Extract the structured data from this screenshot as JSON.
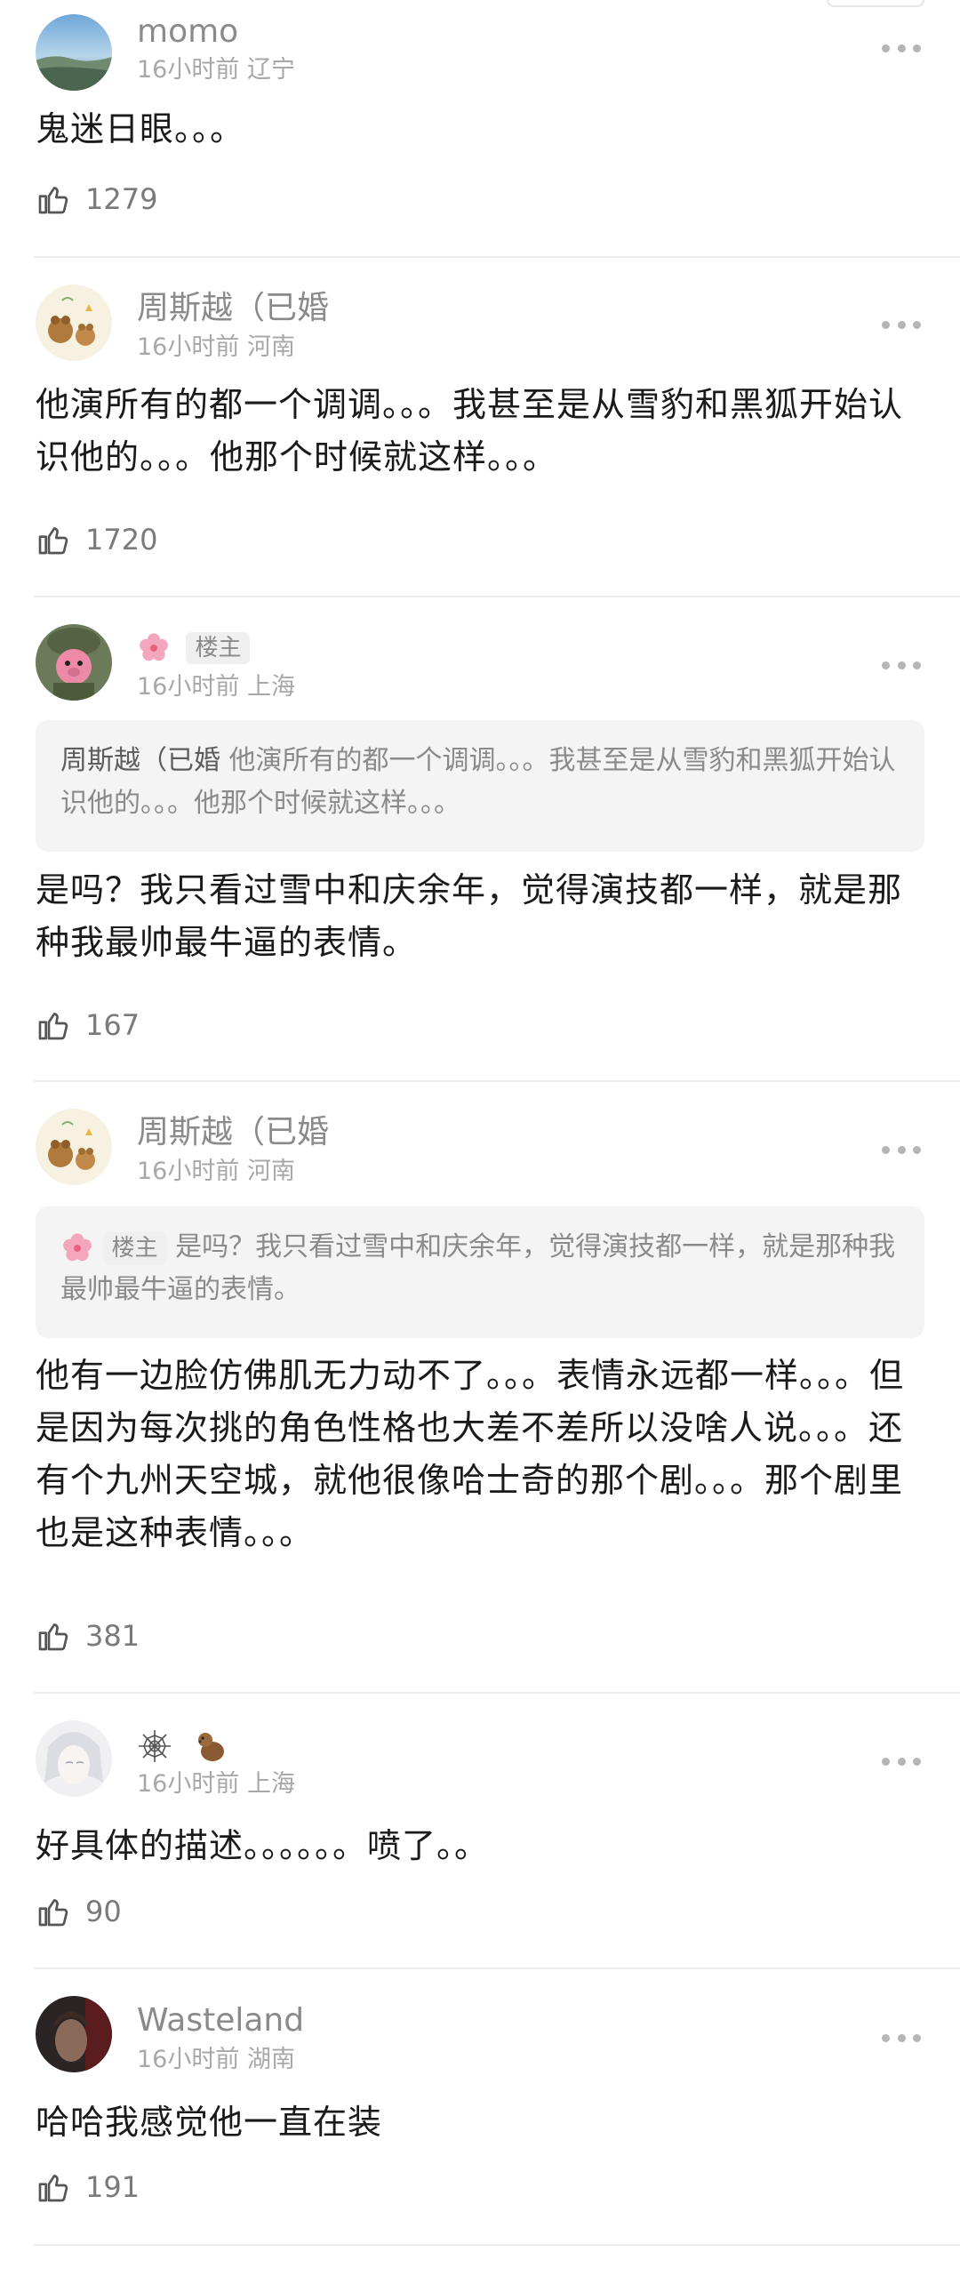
{
  "comments": [
    {
      "username": "momo",
      "time": "16小时前",
      "location": "辽宁",
      "text": "鬼迷日眼。。。",
      "likes": "1279",
      "avatar": "sky-landscape-avatar"
    },
    {
      "username": "周斯越（已婚",
      "time": "16小时前",
      "location": "河南",
      "text": "他演所有的都一个调调。。。我甚至是从雪豹和黑狐开始认识他的。。。他那个时候就这样。。。",
      "likes": "1720",
      "avatar": "cartoon-bears-avatar"
    },
    {
      "username": "",
      "badge": "楼主",
      "time": "16小时前",
      "location": "上海",
      "quote_name": "周斯越（已婚",
      "quote_text": "他演所有的都一个调调。。。我甚至是从雪豹和黑狐开始认识他的。。。他那个时候就这样。。。",
      "text": "是吗？我只看过雪中和庆余年，觉得演技都一样，就是那种我最帅最牛逼的表情。",
      "likes": "167",
      "avatar": "soldier-pig-avatar"
    },
    {
      "username": "周斯越（已婚",
      "time": "16小时前",
      "location": "河南",
      "quote_badge": "楼主",
      "quote_text": "是吗？我只看过雪中和庆余年，觉得演技都一样，就是那种我最帅最牛逼的表情。",
      "text": "他有一边脸仿佛肌无力动不了。。。表情永远都一样。。。但是因为每次挑的角色性格也大差不差所以没啥人说。。。还有个九州天空城，就他很像哈士奇的那个剧。。。那个剧里也是这种表情。。。",
      "likes": "381",
      "avatar": "cartoon-bears-avatar"
    },
    {
      "username": "",
      "time": "16小时前",
      "location": "上海",
      "text": "好具体的描述。。。。。。喷了。。",
      "likes": "90",
      "avatar": "white-hair-anime-avatar"
    },
    {
      "username": "Wasteland",
      "time": "16小时前",
      "location": "湖南",
      "text": "哈哈我感觉他一直在装",
      "likes": "191",
      "avatar": "dark-portrait-avatar"
    }
  ],
  "colors": {
    "text": "#1a1a1a",
    "username": "#8a8a8a",
    "meta": "#a8a8a8",
    "quote_bg": "#f4f4f4",
    "divider": "#ececec"
  }
}
